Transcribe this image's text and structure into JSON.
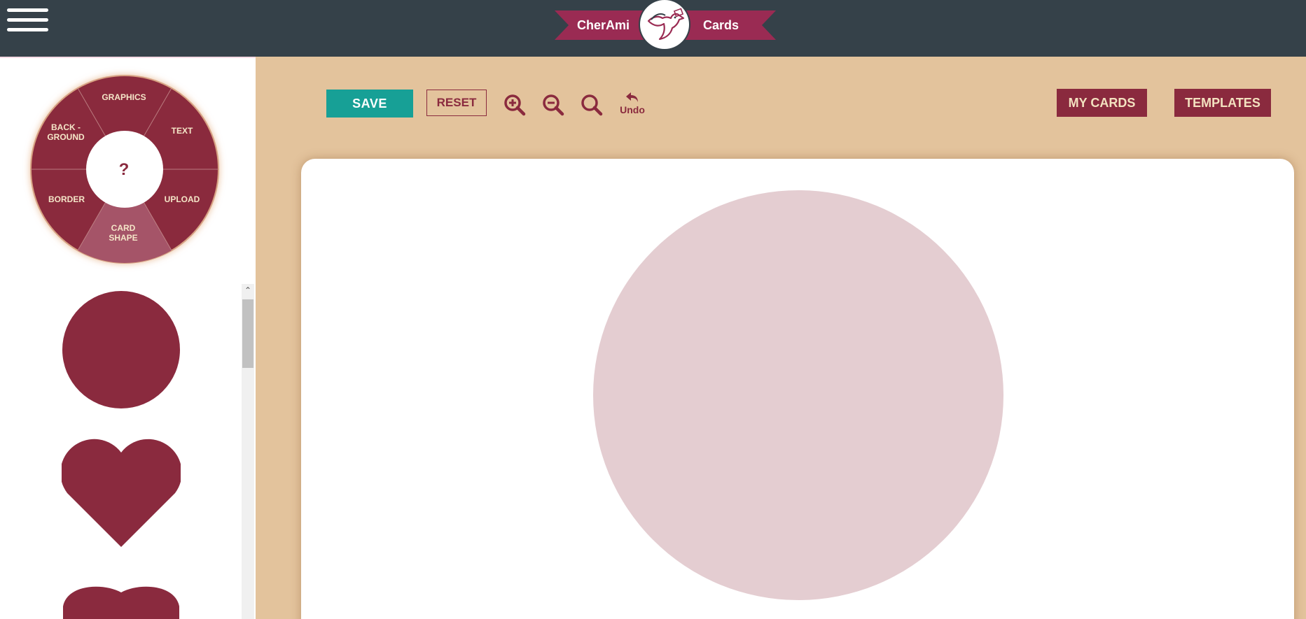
{
  "header": {
    "brand_left": "CherAmi",
    "brand_right": "Cards",
    "menu_icon": "hamburger-menu-icon",
    "logo_icon": "dove-with-letter-icon",
    "background_color": "#354149",
    "ribbon_color": "#9a2b53"
  },
  "wheel": {
    "center_label": "?",
    "segments": {
      "graphics": "GRAPHICS",
      "text": "TEXT",
      "upload": "UPLOAD",
      "card_shape_line1": "CARD",
      "card_shape_line2": "SHAPE",
      "border": "BORDER",
      "background_line1": "BACK -",
      "background_line2": "GROUND"
    },
    "active_segment": "CARD SHAPE",
    "color": "#8a2a3e"
  },
  "shapes": {
    "items": [
      "circle",
      "heart",
      "rounded-heart"
    ],
    "color": "#8a2a3e"
  },
  "toolbar": {
    "save_label": "SAVE",
    "reset_label": "RESET",
    "zoom_in_icon": "zoom-in-icon",
    "zoom_out_icon": "zoom-out-icon",
    "zoom_fit_icon": "search-icon",
    "undo_label": "Undo",
    "my_cards_label": "MY CARDS",
    "templates_label": "TEMPLATES",
    "accent_color": "#17a096",
    "primary_color": "#8a2a3e"
  },
  "canvas": {
    "shape": "circle",
    "shape_color": "#e4cdd1"
  }
}
